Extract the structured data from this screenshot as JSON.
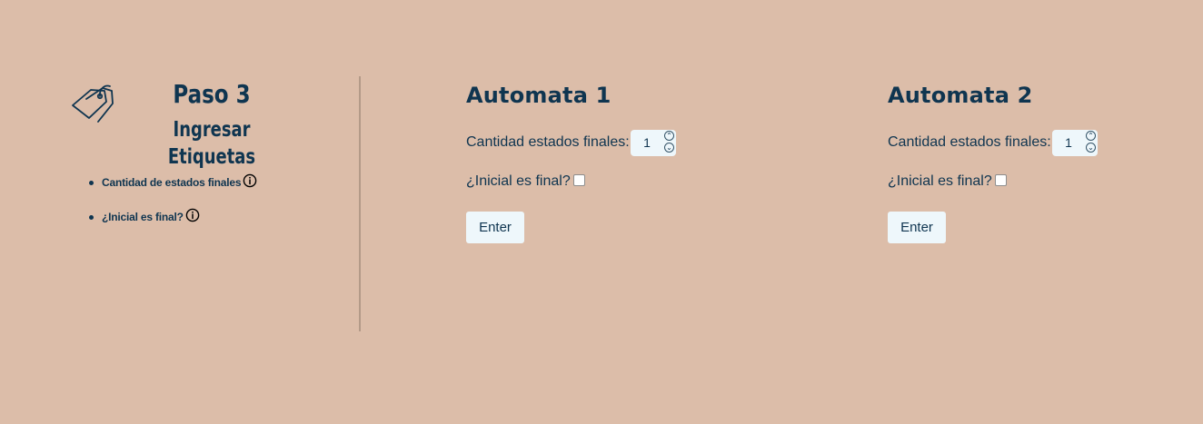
{
  "left_panel": {
    "title": "Paso 3",
    "subtitle": "Ingresar Etiquetas",
    "help_items": [
      {
        "label": "Cantidad de estados finales",
        "icon": "info-icon"
      },
      {
        "label": "¿Inicial es final?",
        "icon": "info-icon"
      }
    ],
    "icon": "tag-icon"
  },
  "automata": [
    {
      "title": "Automata 1",
      "final_states_label": "Cantidad estados finales:",
      "final_states_value": "1",
      "initial_final_label": "¿Inicial es final?",
      "initial_final_checked": false,
      "button_label": "Enter"
    },
    {
      "title": "Automata 2",
      "final_states_label": "Cantidad estados finales:",
      "final_states_value": "1",
      "initial_final_label": "¿Inicial es final?",
      "initial_final_checked": false,
      "button_label": "Enter"
    }
  ],
  "colors": {
    "background": "#dcbda9",
    "text": "#0f3550",
    "control": "#eef7fb",
    "divider": "#b39a88"
  }
}
